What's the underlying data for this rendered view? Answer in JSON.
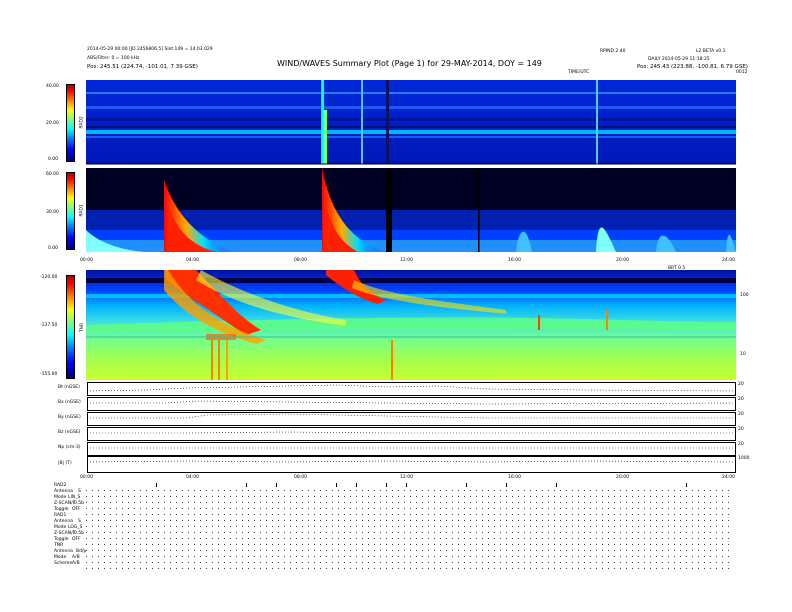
{
  "header": {
    "left_lines": [
      "2014-05-29 00:00 [JD 2456806.5] Slot 149 = 14.03.029",
      "ABS/Filter: 0 = 100 kHz",
      "Pos:   245.51 (224.74, -101.01, 7.39 GSE)"
    ],
    "title": "WIND/WAVES Summary Plot (Page 1) for 29-MAY-2014, DOY = 149",
    "right_lines": [
      "RPIND 2.40",
      "DAILY 2014-05-29 11:18:25",
      "Pos:  245.43 (223.88, -100.81, 6.79 GSE)"
    ],
    "right_corner": "L2 BETA v0.1",
    "small_label_a": "TIME/UTC",
    "small_label_b": "0012"
  },
  "panels": {
    "rad2": {
      "label": "RAD2",
      "ticks": [
        "40.00",
        "20.00",
        "0.00"
      ]
    },
    "rad1": {
      "label": "RAD1",
      "ticks": [
        "60.00",
        "30.00",
        "0.00"
      ]
    },
    "tnr": {
      "label": "TNR",
      "ticks": [
        "-120.00",
        "-137.50",
        "-155.00"
      ],
      "right_ticks": [
        "100",
        "10"
      ],
      "right_corner": "BRT 0.5"
    },
    "time_ticks_top": [
      "00:00",
      "04:00",
      "08:00",
      "12:00",
      "16:00",
      "20:00",
      "24:00"
    ],
    "time_ticks_bottom": [
      "00:00",
      "04:00",
      "08:00",
      "12:00",
      "16:00",
      "20:00",
      "24:00"
    ]
  },
  "mag_rows": [
    {
      "label": "Bt (nGSE)",
      "right": [
        "20",
        "10",
        "0"
      ]
    },
    {
      "label": "Bx (nGSE)",
      "right": [
        "20",
        "0",
        "-20"
      ]
    },
    {
      "label": "By (nGSE)",
      "right": [
        "20",
        "0",
        "-20"
      ]
    },
    {
      "label": "Bz (nGSE)",
      "right": [
        "20",
        "0",
        "-20"
      ]
    },
    {
      "label": "Np (cm-3)",
      "right": [
        "20",
        "10",
        "0"
      ]
    },
    {
      "label": "|B| (T)",
      "right": [
        "1000",
        "500",
        "0"
      ]
    }
  ],
  "footer": {
    "groups": [
      {
        "title": "RAD2",
        "rows": [
          [
            "Antenna",
            "S"
          ],
          [
            "Mode",
            "LIN_S"
          ],
          [
            "Z-SCAN/F",
            "0.5b"
          ],
          [
            "Toggle",
            "OFF"
          ]
        ]
      },
      {
        "title": "RAD1",
        "rows": [
          [
            "Antenna",
            "S"
          ],
          [
            "Mode",
            "LOG_S"
          ],
          [
            "Z-SCAN/F",
            "0.5b"
          ],
          [
            "Toggle",
            "OFF"
          ]
        ]
      },
      {
        "title": "TNR",
        "rows": [
          [
            "Antenna",
            "Bd/p"
          ],
          [
            "Mode",
            "A/B"
          ],
          [
            "Scheme",
            "A/B"
          ]
        ]
      }
    ]
  },
  "chart_data": {
    "type": "heatmap",
    "title": "WIND/WAVES Summary Plot (Page 1) for 29-MAY-2014, DOY = 149",
    "x_range_hours": [
      0,
      24
    ],
    "panels": [
      {
        "name": "RAD2",
        "y_range": [
          0,
          40
        ],
        "events_hours": [
          8.8,
          10.2,
          18.9
        ]
      },
      {
        "name": "RAD1",
        "y_range": [
          0,
          60
        ],
        "events_hours": [
          3.0,
          8.8,
          11.1,
          16.0,
          18.9,
          21.5,
          23.8
        ]
      },
      {
        "name": "TNR",
        "y_range": [
          -155,
          -120
        ],
        "events_hours": [
          3.0,
          8.8,
          11.2,
          17.0,
          19.0
        ]
      }
    ],
    "colorbar": [
      "#00007a",
      "#0000ff",
      "#0080ff",
      "#00ffff",
      "#80ff80",
      "#ffff00",
      "#ff8000",
      "#ff0000",
      "#b00000"
    ]
  }
}
